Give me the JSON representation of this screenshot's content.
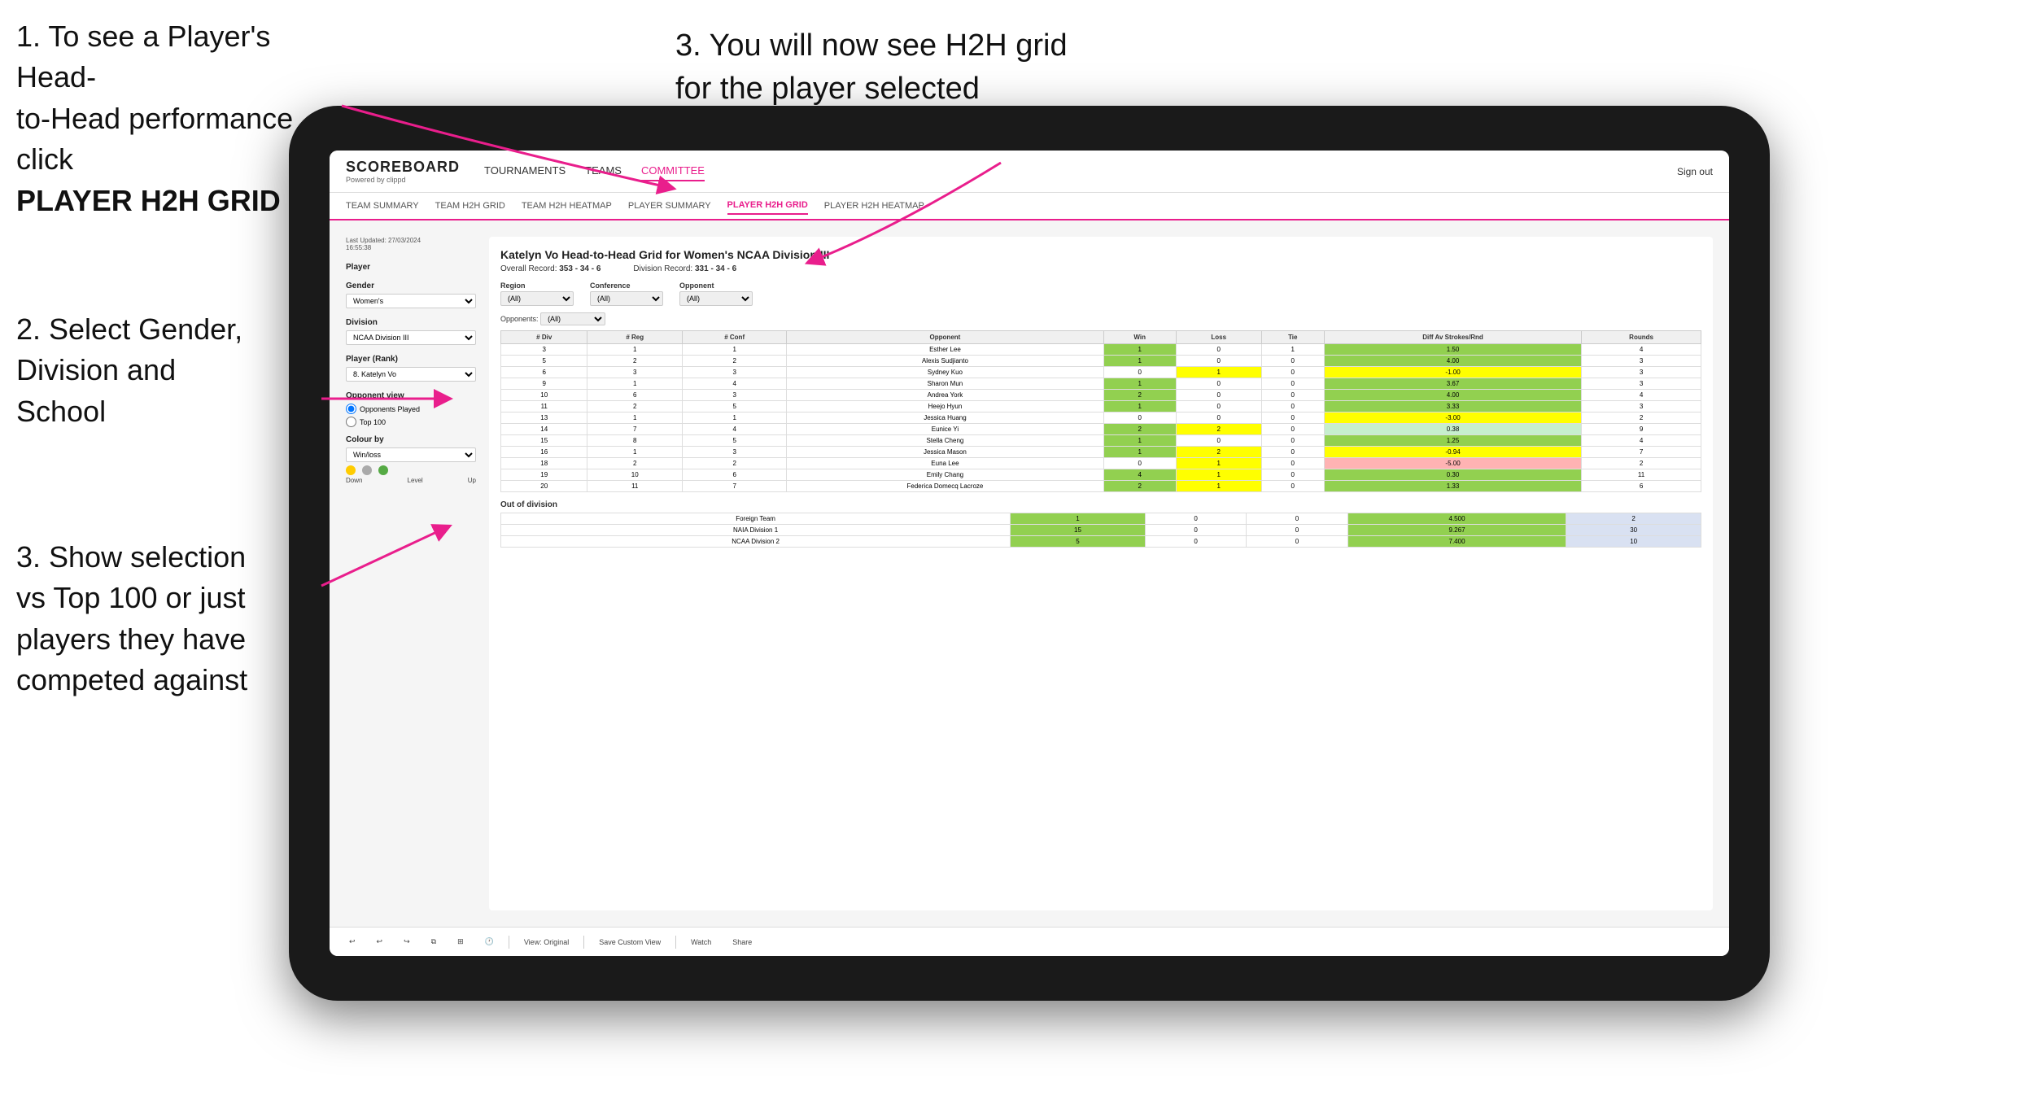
{
  "instructions": {
    "step1_line1": "1. To see a Player's Head-",
    "step1_line2": "to-Head performance click",
    "step1_bold": "PLAYER H2H GRID",
    "step2_line1": "2. Select Gender,",
    "step2_line2": "Division and",
    "step2_line3": "School",
    "step3_left_line1": "3. Show selection",
    "step3_left_line2": "vs Top 100 or just",
    "step3_left_line3": "players they have",
    "step3_left_line4": "competed against",
    "step3_right_line1": "3. You will now see H2H grid",
    "step3_right_line2": "for the player selected"
  },
  "nav": {
    "logo": "SCOREBOARD",
    "logo_sub": "Powered by clippd",
    "links": [
      "TOURNAMENTS",
      "TEAMS",
      "COMMITTEE"
    ],
    "active_link": "COMMITTEE",
    "sign_out": "Sign out"
  },
  "sub_nav": {
    "links": [
      "TEAM SUMMARY",
      "TEAM H2H GRID",
      "TEAM H2H HEATMAP",
      "PLAYER SUMMARY",
      "PLAYER H2H GRID",
      "PLAYER H2H HEATMAP"
    ],
    "active": "PLAYER H2H GRID"
  },
  "left_panel": {
    "last_updated_label": "Last Updated: 27/03/2024",
    "last_updated_time": "16:55:38",
    "player_label": "Player",
    "gender_label": "Gender",
    "gender_value": "Women's",
    "division_label": "Division",
    "division_value": "NCAA Division III",
    "player_rank_label": "Player (Rank)",
    "player_rank_value": "8. Katelyn Vo",
    "opponent_view_label": "Opponent view",
    "radio1": "Opponents Played",
    "radio2": "Top 100",
    "colour_label": "Colour by",
    "colour_value": "Win/loss",
    "legend_down": "Down",
    "legend_level": "Level",
    "legend_up": "Up"
  },
  "main": {
    "title": "Katelyn Vo Head-to-Head Grid for Women's NCAA Division III",
    "overall_record_label": "Overall Record:",
    "overall_record": "353 - 34 - 6",
    "division_record_label": "Division Record:",
    "division_record": "331 - 34 - 6",
    "region_label": "Region",
    "conference_label": "Conference",
    "opponent_label": "Opponent",
    "opponents_label": "Opponents:",
    "all_option": "(All)",
    "table_headers": [
      "# Div",
      "# Reg",
      "# Conf",
      "Opponent",
      "Win",
      "Loss",
      "Tie",
      "Diff Av Strokes/Rnd",
      "Rounds"
    ],
    "rows": [
      {
        "div": "3",
        "reg": "1",
        "conf": "1",
        "opponent": "Esther Lee",
        "win": "1",
        "loss": "0",
        "tie": "1",
        "diff": "1.50",
        "rounds": "4",
        "color": "green"
      },
      {
        "div": "5",
        "reg": "2",
        "conf": "2",
        "opponent": "Alexis Sudjianto",
        "win": "1",
        "loss": "0",
        "tie": "0",
        "diff": "4.00",
        "rounds": "3",
        "color": "green"
      },
      {
        "div": "6",
        "reg": "3",
        "conf": "3",
        "opponent": "Sydney Kuo",
        "win": "0",
        "loss": "1",
        "tie": "0",
        "diff": "-1.00",
        "rounds": "3",
        "color": "yellow"
      },
      {
        "div": "9",
        "reg": "1",
        "conf": "4",
        "opponent": "Sharon Mun",
        "win": "1",
        "loss": "0",
        "tie": "0",
        "diff": "3.67",
        "rounds": "3",
        "color": "green"
      },
      {
        "div": "10",
        "reg": "6",
        "conf": "3",
        "opponent": "Andrea York",
        "win": "2",
        "loss": "0",
        "tie": "0",
        "diff": "4.00",
        "rounds": "4",
        "color": "green"
      },
      {
        "div": "11",
        "reg": "2",
        "conf": "5",
        "opponent": "Heejo Hyun",
        "win": "1",
        "loss": "0",
        "tie": "0",
        "diff": "3.33",
        "rounds": "3",
        "color": "green"
      },
      {
        "div": "13",
        "reg": "1",
        "conf": "1",
        "opponent": "Jessica Huang",
        "win": "0",
        "loss": "0",
        "tie": "0",
        "diff": "-3.00",
        "rounds": "2",
        "color": "yellow"
      },
      {
        "div": "14",
        "reg": "7",
        "conf": "4",
        "opponent": "Eunice Yi",
        "win": "2",
        "loss": "2",
        "tie": "0",
        "diff": "0.38",
        "rounds": "9",
        "color": "light"
      },
      {
        "div": "15",
        "reg": "8",
        "conf": "5",
        "opponent": "Stella Cheng",
        "win": "1",
        "loss": "0",
        "tie": "0",
        "diff": "1.25",
        "rounds": "4",
        "color": "green"
      },
      {
        "div": "16",
        "reg": "1",
        "conf": "3",
        "opponent": "Jessica Mason",
        "win": "1",
        "loss": "2",
        "tie": "0",
        "diff": "-0.94",
        "rounds": "7",
        "color": "yellow"
      },
      {
        "div": "18",
        "reg": "2",
        "conf": "2",
        "opponent": "Euna Lee",
        "win": "0",
        "loss": "1",
        "tie": "0",
        "diff": "-5.00",
        "rounds": "2",
        "color": "red"
      },
      {
        "div": "19",
        "reg": "10",
        "conf": "6",
        "opponent": "Emily Chang",
        "win": "4",
        "loss": "1",
        "tie": "0",
        "diff": "0.30",
        "rounds": "11",
        "color": "green"
      },
      {
        "div": "20",
        "reg": "11",
        "conf": "7",
        "opponent": "Federica Domecq Lacroze",
        "win": "2",
        "loss": "1",
        "tie": "0",
        "diff": "1.33",
        "rounds": "6",
        "color": "green"
      }
    ],
    "out_of_division_label": "Out of division",
    "out_of_division_rows": [
      {
        "label": "Foreign Team",
        "win": "1",
        "loss": "0",
        "tie": "0",
        "diff": "4.500",
        "rounds": "2",
        "color": "green"
      },
      {
        "label": "NAIA Division 1",
        "win": "15",
        "loss": "0",
        "tie": "0",
        "diff": "9.267",
        "rounds": "30",
        "color": "green"
      },
      {
        "label": "NCAA Division 2",
        "win": "5",
        "loss": "0",
        "tie": "0",
        "diff": "7.400",
        "rounds": "10",
        "color": "green"
      }
    ]
  },
  "toolbar": {
    "view_original": "View: Original",
    "save_custom": "Save Custom View",
    "watch": "Watch",
    "share": "Share"
  }
}
